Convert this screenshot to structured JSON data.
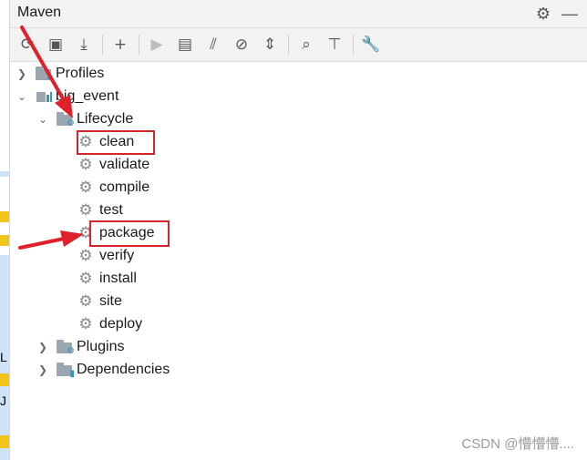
{
  "panel": {
    "title": "Maven",
    "settings_icon": "gear-icon",
    "minimize_icon": "minimize-icon"
  },
  "toolbar": {
    "buttons": [
      {
        "name": "reload-icon",
        "glyph": "⟳"
      },
      {
        "name": "add-maven-project-icon",
        "glyph": "▣"
      },
      {
        "name": "download-icon",
        "glyph": "⤓"
      },
      {
        "name": "add-icon",
        "glyph": "+"
      },
      {
        "name": "run-icon",
        "glyph": "▶"
      },
      {
        "name": "execute-goal-icon",
        "glyph": "▤"
      },
      {
        "name": "toggle-offline-icon",
        "glyph": "⫽"
      },
      {
        "name": "skip-tests-icon",
        "glyph": "⊘"
      },
      {
        "name": "collapse-all-icon",
        "glyph": "⇕"
      },
      {
        "name": "show-dependencies-icon",
        "glyph": "⌕"
      },
      {
        "name": "expand-icon",
        "glyph": "⊤"
      },
      {
        "name": "settings-wrench-icon",
        "glyph": "🔧"
      }
    ]
  },
  "tree": {
    "profiles": "Profiles",
    "project": "big_event",
    "lifecycle": "Lifecycle",
    "phases": [
      "clean",
      "validate",
      "compile",
      "test",
      "package",
      "verify",
      "install",
      "site",
      "deploy"
    ],
    "plugins": "Plugins",
    "dependencies": "Dependencies"
  },
  "left_strip": {
    "chars": [
      "L",
      "J"
    ]
  },
  "watermark": "CSDN @懵懵懵....",
  "colors": {
    "highlight": "#d6242c",
    "accent": "#3592c4"
  }
}
